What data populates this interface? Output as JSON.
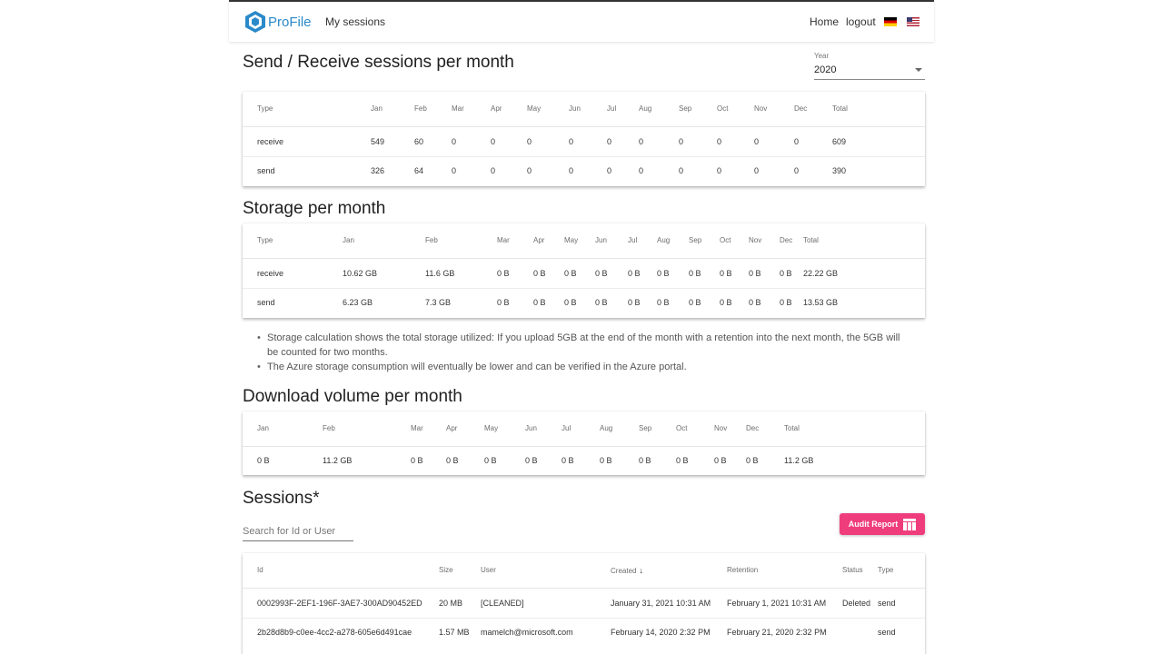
{
  "header": {
    "app_name": "ProFile",
    "nav_my_sessions": "My sessions",
    "nav_home": "Home",
    "nav_logout": "logout"
  },
  "sessions_per_month": {
    "title": "Send / Receive sessions per month",
    "year_label": "Year",
    "year_value": "2020",
    "columns": [
      "Type",
      "Jan",
      "Feb",
      "Mar",
      "Apr",
      "May",
      "Jun",
      "Jul",
      "Aug",
      "Sep",
      "Oct",
      "Nov",
      "Dec",
      "Total"
    ],
    "rows": [
      [
        "receive",
        "549",
        "60",
        "0",
        "0",
        "0",
        "0",
        "0",
        "0",
        "0",
        "0",
        "0",
        "0",
        "609"
      ],
      [
        "send",
        "326",
        "64",
        "0",
        "0",
        "0",
        "0",
        "0",
        "0",
        "0",
        "0",
        "0",
        "0",
        "390"
      ]
    ]
  },
  "storage_per_month": {
    "title": "Storage per month",
    "columns": [
      "Type",
      "Jan",
      "Feb",
      "Mar",
      "Apr",
      "May",
      "Jun",
      "Jul",
      "Aug",
      "Sep",
      "Oct",
      "Nov",
      "Dec",
      "Total"
    ],
    "rows": [
      [
        "receive",
        "10.62 GB",
        "11.6 GB",
        "0 B",
        "0 B",
        "0 B",
        "0 B",
        "0 B",
        "0 B",
        "0 B",
        "0 B",
        "0 B",
        "0 B",
        "22.22 GB"
      ],
      [
        "send",
        "6.23 GB",
        "7.3 GB",
        "0 B",
        "0 B",
        "0 B",
        "0 B",
        "0 B",
        "0 B",
        "0 B",
        "0 B",
        "0 B",
        "0 B",
        "13.53 GB"
      ]
    ],
    "notes": [
      "Storage calculation shows the total storage utilized: If you upload 5GB at the end of the month with a retention into the next month, the 5GB will be counted for two months.",
      "The Azure storage consumption will eventually be lower and can be verified in the Azure portal."
    ]
  },
  "download_per_month": {
    "title": "Download volume per month",
    "columns": [
      "Jan",
      "Feb",
      "Mar",
      "Apr",
      "May",
      "Jun",
      "Jul",
      "Aug",
      "Sep",
      "Oct",
      "Nov",
      "Dec",
      "Total"
    ],
    "rows": [
      [
        "0 B",
        "11.2 GB",
        "0 B",
        "0 B",
        "0 B",
        "0 B",
        "0 B",
        "0 B",
        "0 B",
        "0 B",
        "0 B",
        "0 B",
        "11.2 GB"
      ]
    ]
  },
  "sessions": {
    "title": "Sessions*",
    "search_placeholder": "Search for Id or User",
    "audit_button": "Audit Report",
    "sort_indicator": "↓",
    "columns": [
      "Id",
      "Size",
      "User",
      "Created",
      "Retention",
      "Status",
      "Type"
    ],
    "rows": [
      [
        "0002993F-2EF1-196F-3AE7-300AD90452ED",
        "20 MB",
        "[CLEANED]",
        "January 31, 2021 10:31 AM",
        "February 1, 2021 10:31 AM",
        "Deleted",
        "send"
      ],
      [
        "2b28d8b9-c0ee-4cc2-a278-605e6d491cae",
        "1.57 MB",
        "mamelch@microsoft.com",
        "February 14, 2020 2:32 PM",
        "February 21, 2020 2:32 PM",
        "",
        "send"
      ]
    ]
  },
  "colors": {
    "brand": "#2a8ac9",
    "accent": "#ef3d7c"
  },
  "icons": {
    "logo": "profile-cube-logo-icon",
    "audit": "table-icon",
    "select": "chevron-down-icon",
    "sort": "arrow-down-icon"
  }
}
